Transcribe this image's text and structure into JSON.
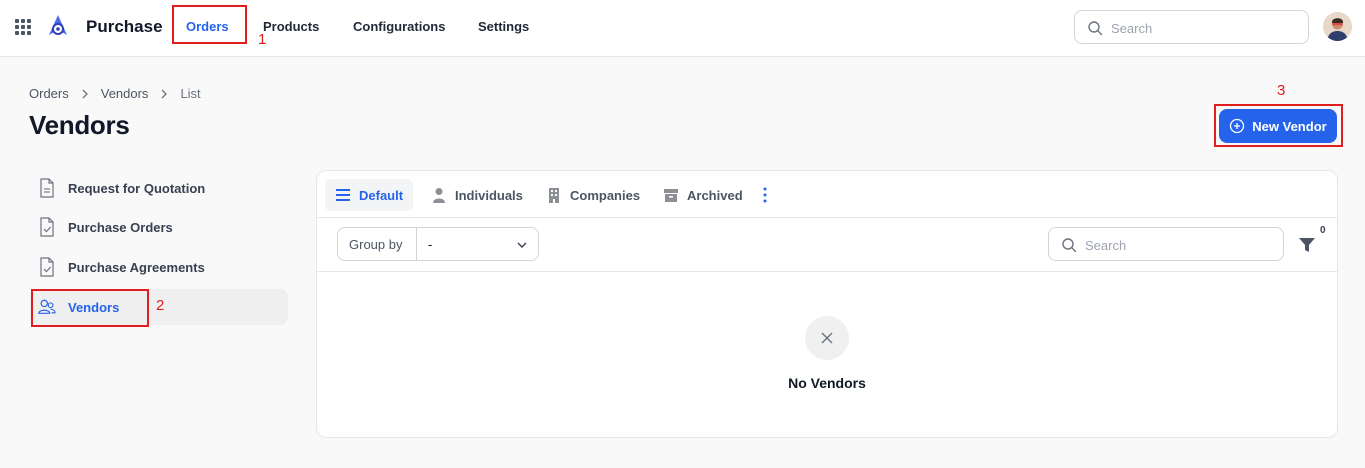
{
  "app": {
    "name": "Purchase"
  },
  "nav": {
    "items": [
      {
        "label": "Orders"
      },
      {
        "label": "Products"
      },
      {
        "label": "Configurations"
      },
      {
        "label": "Settings"
      }
    ]
  },
  "top_search": {
    "placeholder": "Search"
  },
  "breadcrumb": {
    "items": [
      "Orders",
      "Vendors",
      "List"
    ]
  },
  "page": {
    "title": "Vendors",
    "new_button_label": "New Vendor"
  },
  "sidebar": {
    "items": [
      {
        "label": "Request for Quotation",
        "icon": "document-icon"
      },
      {
        "label": "Purchase Orders",
        "icon": "document-check-icon"
      },
      {
        "label": "Purchase Agreements",
        "icon": "document-check-icon"
      },
      {
        "label": "Vendors",
        "icon": "users-icon",
        "active": true
      }
    ]
  },
  "tabs": {
    "items": [
      {
        "label": "Default",
        "icon": "list-icon",
        "active": true
      },
      {
        "label": "Individuals",
        "icon": "user-icon"
      },
      {
        "label": "Companies",
        "icon": "building-icon"
      },
      {
        "label": "Archived",
        "icon": "archive-icon"
      }
    ]
  },
  "filters": {
    "group_by_label": "Group by",
    "group_by_value": "-",
    "search_placeholder": "Search",
    "filter_count": "0"
  },
  "empty_state": {
    "message": "No Vendors"
  },
  "annotations": [
    "1",
    "2",
    "3"
  ],
  "colors": {
    "accent": "#2563eb",
    "annotation": "#e11d1d"
  }
}
